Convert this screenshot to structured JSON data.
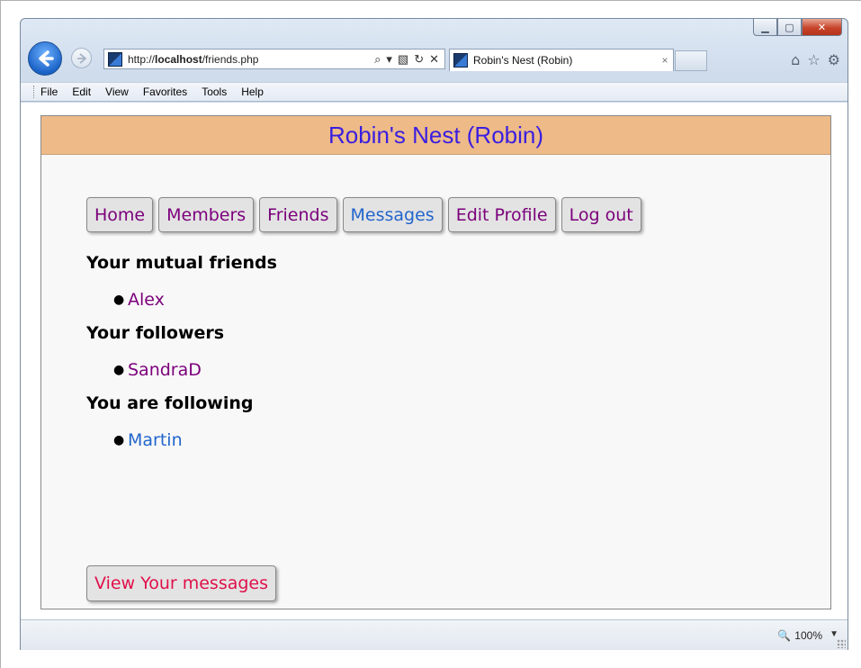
{
  "browser": {
    "url_prefix": "http://",
    "url_host": "localhost",
    "url_path": "/friends.php",
    "tab_title": "Robin's Nest (Robin)",
    "tab_close": "×",
    "menu": [
      "File",
      "Edit",
      "View",
      "Favorites",
      "Tools",
      "Help"
    ],
    "window_controls": {
      "minimize": "▁",
      "maximize": "▢",
      "close": "✕"
    },
    "toolbar_icons": [
      "home-icon",
      "favorites-star-icon",
      "settings-gear-icon"
    ]
  },
  "page": {
    "header_title": "Robin's Nest (Robin)",
    "nav": [
      {
        "label": "Home",
        "state": "visited"
      },
      {
        "label": "Members",
        "state": "visited"
      },
      {
        "label": "Friends",
        "state": "visited"
      },
      {
        "label": "Messages",
        "state": "unvisited"
      },
      {
        "label": "Edit Profile",
        "state": "visited"
      },
      {
        "label": "Log out",
        "state": "visited"
      }
    ],
    "sections": [
      {
        "title": "Your mutual friends",
        "items": [
          {
            "name": "Alex",
            "state": "visited"
          }
        ]
      },
      {
        "title": "Your followers",
        "items": [
          {
            "name": "SandraD",
            "state": "visited"
          }
        ]
      },
      {
        "title": "You are following",
        "items": [
          {
            "name": "Martin",
            "state": "unvisited"
          }
        ]
      }
    ],
    "messages_button": "View Your messages"
  },
  "status": {
    "zoom": "100%"
  },
  "colors": {
    "header_bg": "#eeba88",
    "header_text": "#3a1ee0",
    "visited_link": "#7b007b",
    "unvisited_link": "#2266cc",
    "messages_button_text": "#e0104a"
  }
}
